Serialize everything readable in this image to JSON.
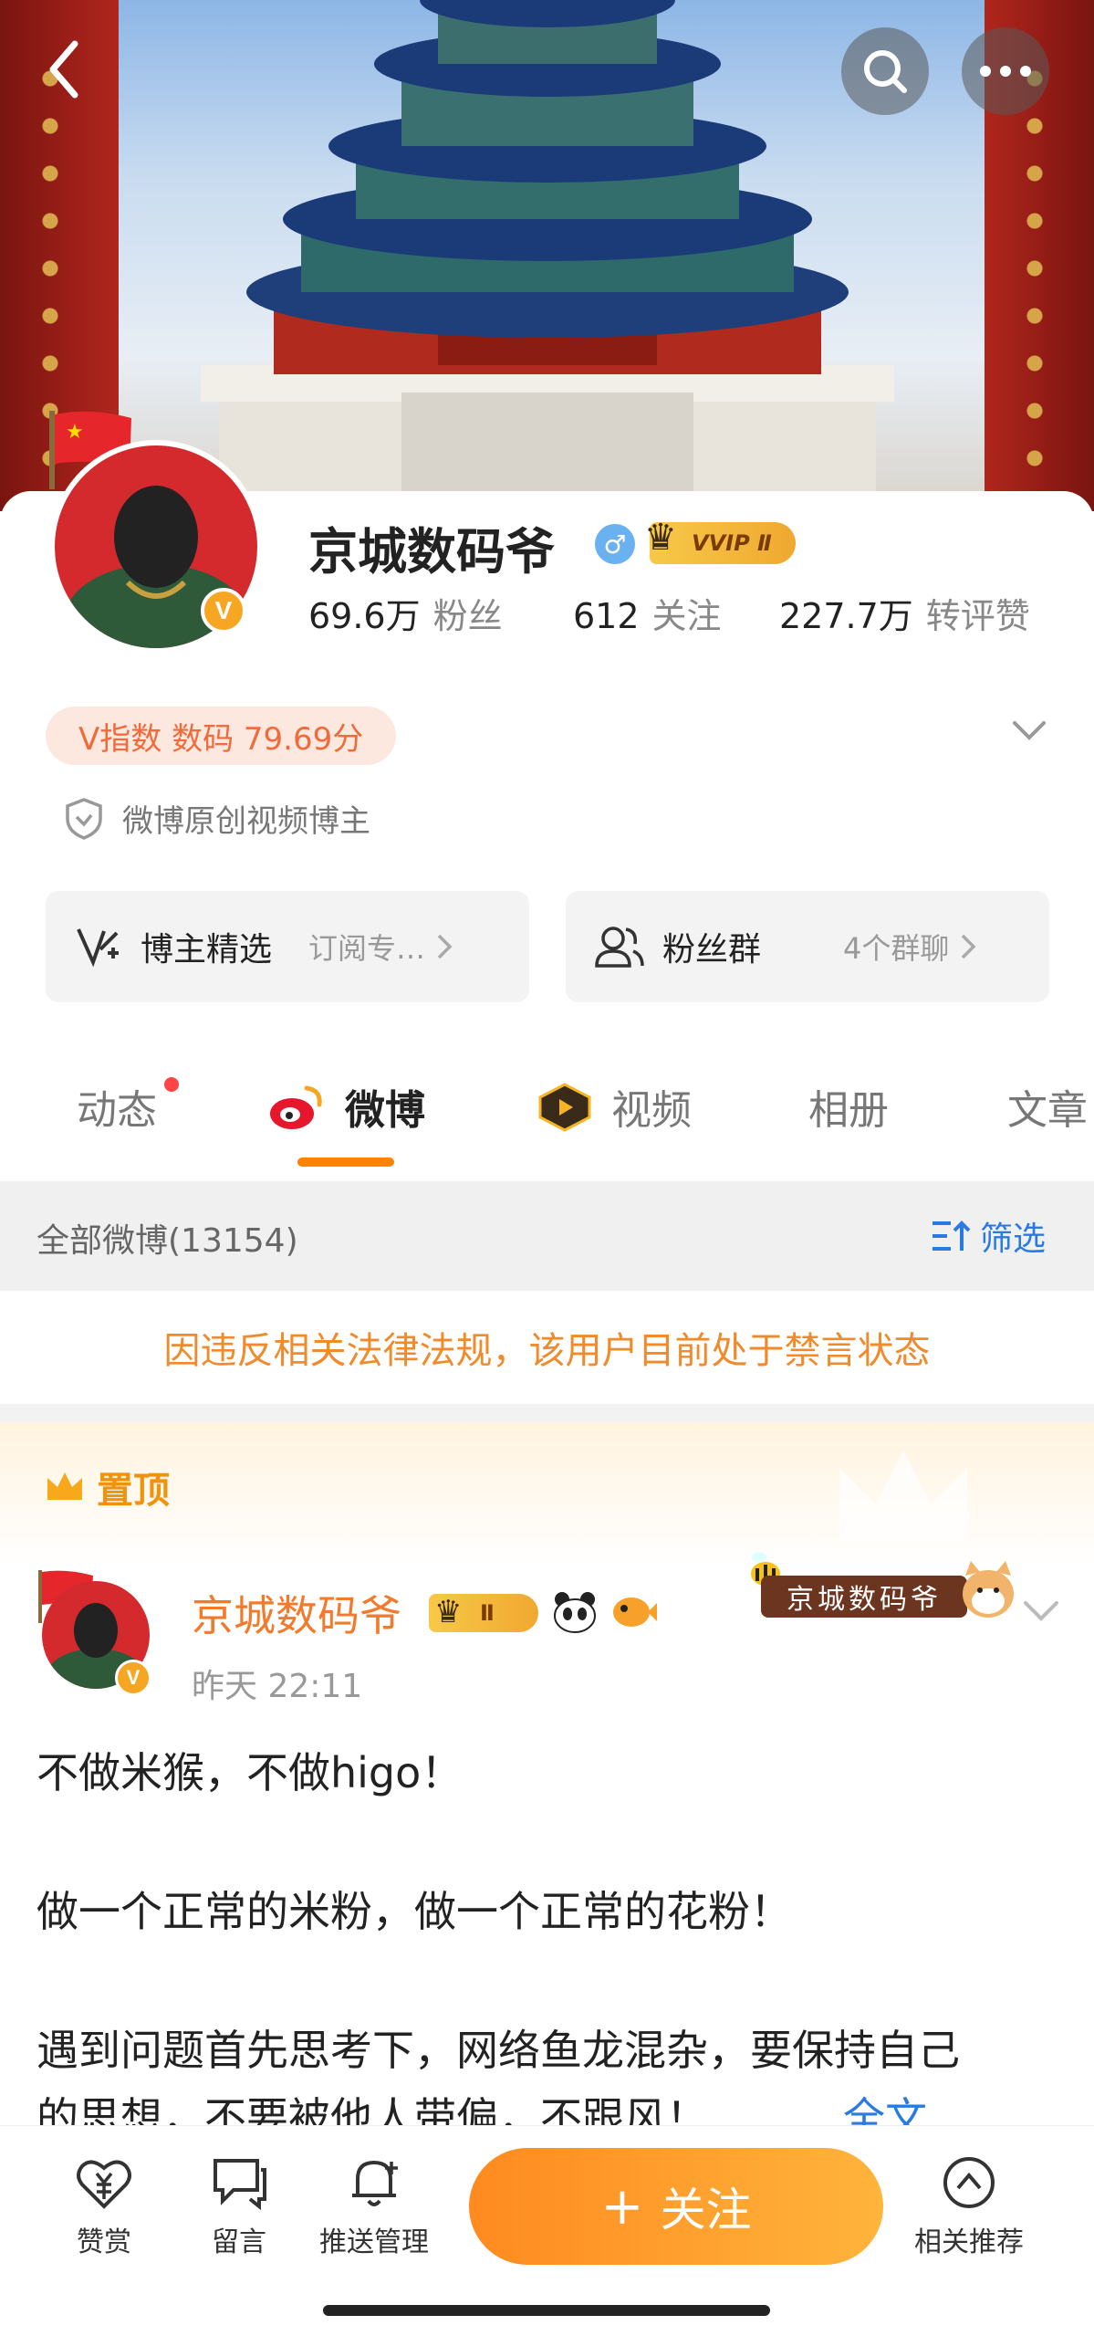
{
  "profile": {
    "name": "京城数码爷",
    "gender_symbol": "♂",
    "vip_badge": "VVIP Ⅱ",
    "v_badge": "V",
    "stats": [
      {
        "value": "69.6万",
        "label": "粉丝"
      },
      {
        "value": "612",
        "label": "关注"
      },
      {
        "value": "227.7万",
        "label": "转评赞"
      }
    ],
    "v_index": "V指数 数码 79.69分",
    "creator_tag": "微博原创视频博主"
  },
  "entries": [
    {
      "title": "博主精选",
      "sub": "订阅专…"
    },
    {
      "title": "粉丝群",
      "sub": "4个群聊"
    }
  ],
  "tabs": [
    {
      "label": "动态"
    },
    {
      "label": "微博"
    },
    {
      "label": "视频"
    },
    {
      "label": "相册"
    },
    {
      "label": "文章"
    }
  ],
  "filter": {
    "count_label": "全部微博(13154)",
    "filter_label": "筛选"
  },
  "notice": "因违反相关法律法规，该用户目前处于禁言状态",
  "pinned": {
    "label": "置顶",
    "sticker_text": "京城数码爷"
  },
  "post": {
    "author": "京城数码爷",
    "level_badge": "Ⅱ",
    "time": "昨天 22:11",
    "lines": [
      "不做米猴，不做higo！",
      "做一个正常的米粉，做一个正常的花粉！",
      "遇到问题首先思考下，网络鱼龙混杂，要保持自己",
      "的思想，不要被他人带偏，不跟风！"
    ],
    "more": "全文"
  },
  "bottom_bar": {
    "reward": "赞赏",
    "message": "留言",
    "push": "推送管理",
    "follow": "关注",
    "follow_plus": "+",
    "related": "相关推荐"
  },
  "colors": {
    "accent": "#ff8200",
    "notice": "#f08a2a",
    "vindex_bg": "#fde8e0",
    "link": "#2a7ae2"
  },
  "icons": [
    "back-icon",
    "search-icon",
    "more-icon",
    "verified-icon",
    "shield-icon",
    "chevron-down-icon",
    "chevron-right-icon",
    "edit-icon",
    "group-icon",
    "weibo-logo-icon",
    "video-icon",
    "filter-icon",
    "crown-icon",
    "reward-icon",
    "comment-icon",
    "bell-icon",
    "related-icon"
  ]
}
